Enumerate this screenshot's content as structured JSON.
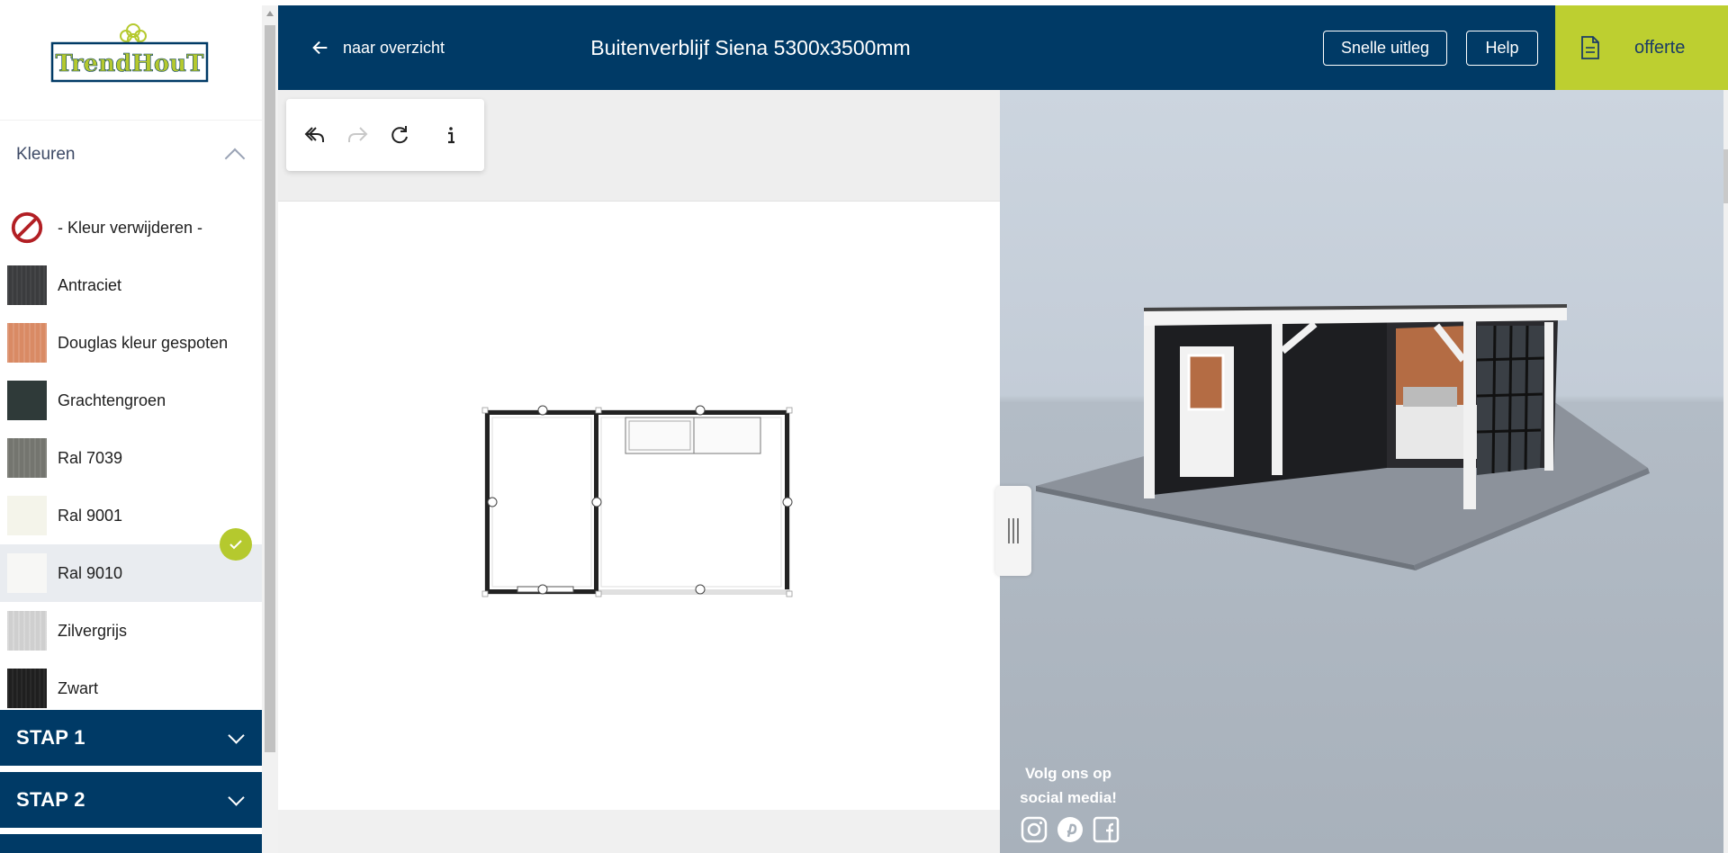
{
  "brand": {
    "logo_text": "TrendHouT"
  },
  "sidebar": {
    "section_title": "Kleuren",
    "colors": [
      {
        "label": "- Kleur verwijderen -",
        "swatch": "none",
        "selected": false
      },
      {
        "label": "Antraciet",
        "swatch": "#3b3c3e",
        "selected": false
      },
      {
        "label": "Douglas kleur gespoten",
        "swatch": "#d98a64",
        "selected": false
      },
      {
        "label": "Grachtengroen",
        "swatch": "#2f3a39",
        "selected": false
      },
      {
        "label": "Ral 7039",
        "swatch": "#74756f",
        "selected": false
      },
      {
        "label": "Ral 9001",
        "swatch": "#f4f4ea",
        "selected": false
      },
      {
        "label": "Ral 9010",
        "swatch": "#f7f7f5",
        "selected": true
      },
      {
        "label": "Zilvergrijs",
        "swatch": "#cfcfcf",
        "selected": false
      },
      {
        "label": "Zwart",
        "swatch": "#1f1f1f",
        "selected": false
      }
    ],
    "steps": [
      {
        "label": "STAP 1"
      },
      {
        "label": "STAP 2"
      }
    ]
  },
  "header": {
    "back_label": "naar overzicht",
    "title": "Buitenverblijf Siena 5300x3500mm",
    "quick_help_label": "Snelle uitleg",
    "help_label": "Help",
    "offerte_label": "offerte"
  },
  "toolbar": {
    "tools": [
      "undo-icon",
      "redo-icon",
      "refresh-icon",
      "info-icon"
    ]
  },
  "view3d": {
    "social_text_line1": "Volg ons op",
    "social_text_line2": "social media!",
    "social_icons": [
      "instagram-icon",
      "pinterest-icon",
      "facebook-icon"
    ]
  },
  "colors": {
    "primary": "#003a66",
    "accent": "#bdcf30"
  }
}
